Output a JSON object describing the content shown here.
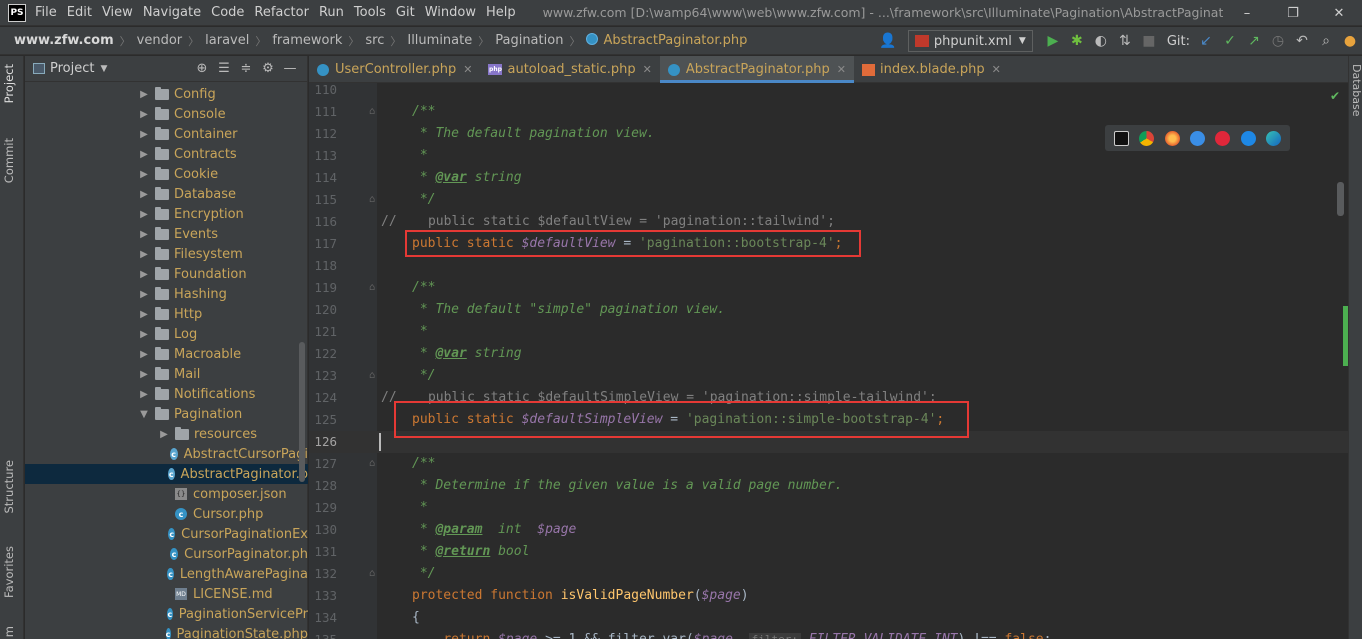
{
  "app": {
    "logo": "PS",
    "menu": [
      "File",
      "Edit",
      "View",
      "Navigate",
      "Code",
      "Refactor",
      "Run",
      "Tools",
      "Git",
      "Window",
      "Help"
    ],
    "window_title": "www.zfw.com [D:\\wamp64\\www\\web\\www.zfw.com] - ...\\framework\\src\\Illuminate\\Pagination\\AbstractPaginator.php",
    "controls": {
      "minimize": "–",
      "restore": "❐",
      "close": "✕"
    }
  },
  "breadcrumb": [
    "www.zfw.com",
    "vendor",
    "laravel",
    "framework",
    "src",
    "Illuminate",
    "Pagination",
    "AbstractPaginator.php"
  ],
  "toolbar": {
    "run_config": "phpunit.xml",
    "git_label": "Git:"
  },
  "left_strip": {
    "project": "Project",
    "commit": "Commit",
    "structure": "Structure",
    "favorites": "Favorites",
    "bottom": "m"
  },
  "right_strip": {
    "database": "Database"
  },
  "project_panel": {
    "title": "Project",
    "tree": [
      {
        "label": "Config",
        "type": "folder",
        "depth": 1
      },
      {
        "label": "Console",
        "type": "folder",
        "depth": 1
      },
      {
        "label": "Container",
        "type": "folder",
        "depth": 1
      },
      {
        "label": "Contracts",
        "type": "folder",
        "depth": 1
      },
      {
        "label": "Cookie",
        "type": "folder",
        "depth": 1
      },
      {
        "label": "Database",
        "type": "folder",
        "depth": 1
      },
      {
        "label": "Encryption",
        "type": "folder",
        "depth": 1
      },
      {
        "label": "Events",
        "type": "folder",
        "depth": 1
      },
      {
        "label": "Filesystem",
        "type": "folder",
        "depth": 1
      },
      {
        "label": "Foundation",
        "type": "folder",
        "depth": 1
      },
      {
        "label": "Hashing",
        "type": "folder",
        "depth": 1
      },
      {
        "label": "Http",
        "type": "folder",
        "depth": 1
      },
      {
        "label": "Log",
        "type": "folder",
        "depth": 1
      },
      {
        "label": "Macroable",
        "type": "folder",
        "depth": 1
      },
      {
        "label": "Mail",
        "type": "folder",
        "depth": 1
      },
      {
        "label": "Notifications",
        "type": "folder",
        "depth": 1
      },
      {
        "label": "Pagination",
        "type": "folder-open",
        "depth": 1
      },
      {
        "label": "resources",
        "type": "folder",
        "depth": 2
      },
      {
        "label": "AbstractCursorPagi",
        "type": "class-abstract",
        "depth": 2
      },
      {
        "label": "AbstractPaginator.p",
        "type": "class-abstract",
        "depth": 2,
        "selected": true
      },
      {
        "label": "composer.json",
        "type": "json",
        "depth": 2
      },
      {
        "label": "Cursor.php",
        "type": "class",
        "depth": 2
      },
      {
        "label": "CursorPaginationEx",
        "type": "class",
        "depth": 2
      },
      {
        "label": "CursorPaginator.ph",
        "type": "class",
        "depth": 2
      },
      {
        "label": "LengthAwarePagina",
        "type": "class",
        "depth": 2
      },
      {
        "label": "LICENSE.md",
        "type": "md",
        "depth": 2
      },
      {
        "label": "PaginationServicePr",
        "type": "class",
        "depth": 2
      },
      {
        "label": "PaginationState.php",
        "type": "class",
        "depth": 2
      }
    ]
  },
  "tabs": [
    {
      "label": "UserController.php",
      "icon": "class",
      "active": false
    },
    {
      "label": "autoload_static.php",
      "icon": "php",
      "active": false
    },
    {
      "label": "AbstractPaginator.php",
      "icon": "class",
      "active": true
    },
    {
      "label": "index.blade.php",
      "icon": "blade",
      "active": false
    }
  ],
  "editor": {
    "current_line": 126,
    "lines": [
      {
        "n": "110",
        "segs": []
      },
      {
        "n": "111",
        "segs": [
          [
            "c-doc",
            "/**"
          ]
        ]
      },
      {
        "n": "112",
        "segs": [
          [
            "c-doc",
            " * The default pagination view."
          ]
        ]
      },
      {
        "n": "113",
        "segs": [
          [
            "c-doc",
            " *"
          ]
        ]
      },
      {
        "n": "114",
        "segs": [
          [
            "c-doc",
            " * "
          ],
          [
            "c-tag",
            "@var"
          ],
          [
            "c-doc",
            " string"
          ]
        ]
      },
      {
        "n": "115",
        "segs": [
          [
            "c-doc",
            " */"
          ]
        ]
      },
      {
        "n": "116",
        "segs": [
          [
            "c-line",
            "//    public static $defaultView = 'pagination::tailwind';"
          ]
        ],
        "comment_out": true
      },
      {
        "n": "117",
        "segs": [
          [
            "kw",
            "public static "
          ],
          [
            "var",
            "$defaultView"
          ],
          [
            "pl",
            " = "
          ],
          [
            "str",
            "'pagination::bootstrap-4'"
          ],
          [
            "kw",
            ";"
          ]
        ]
      },
      {
        "n": "118",
        "segs": []
      },
      {
        "n": "119",
        "segs": [
          [
            "c-doc",
            "/**"
          ]
        ]
      },
      {
        "n": "120",
        "segs": [
          [
            "c-doc",
            " * The default \"simple\" pagination view."
          ]
        ]
      },
      {
        "n": "121",
        "segs": [
          [
            "c-doc",
            " *"
          ]
        ]
      },
      {
        "n": "122",
        "segs": [
          [
            "c-doc",
            " * "
          ],
          [
            "c-tag",
            "@var"
          ],
          [
            "c-doc",
            " string"
          ]
        ]
      },
      {
        "n": "123",
        "segs": [
          [
            "c-doc",
            " */"
          ]
        ]
      },
      {
        "n": "124",
        "segs": [
          [
            "c-line",
            "//    public static $defaultSimpleView = 'pagination::simple-tailwind';"
          ]
        ],
        "comment_out": true
      },
      {
        "n": "125",
        "segs": [
          [
            "kw",
            "public static "
          ],
          [
            "var",
            "$defaultSimpleView"
          ],
          [
            "pl",
            " = "
          ],
          [
            "str",
            "'pagination::simple-bootstrap-4'"
          ],
          [
            "kw",
            ";"
          ]
        ]
      },
      {
        "n": "126",
        "segs": []
      },
      {
        "n": "127",
        "segs": [
          [
            "c-doc",
            "/**"
          ]
        ]
      },
      {
        "n": "128",
        "segs": [
          [
            "c-doc",
            " * Determine if the given value is a valid page number."
          ]
        ]
      },
      {
        "n": "129",
        "segs": [
          [
            "c-doc",
            " *"
          ]
        ]
      },
      {
        "n": "130",
        "segs": [
          [
            "c-doc",
            " * "
          ],
          [
            "c-tag",
            "@param"
          ],
          [
            "c-doc",
            "  int  "
          ],
          [
            "var",
            "$page"
          ]
        ]
      },
      {
        "n": "131",
        "segs": [
          [
            "c-doc",
            " * "
          ],
          [
            "c-tag",
            "@return"
          ],
          [
            "c-doc",
            " bool"
          ]
        ]
      },
      {
        "n": "132",
        "segs": [
          [
            "c-doc",
            " */"
          ]
        ]
      },
      {
        "n": "133",
        "segs": [
          [
            "kw",
            "protected function "
          ],
          [
            "fn",
            "isValidPageNumber"
          ],
          [
            "pl",
            "("
          ],
          [
            "var",
            "$page"
          ],
          [
            "pl",
            ")"
          ]
        ]
      },
      {
        "n": "134",
        "segs": [
          [
            "pl",
            "{"
          ]
        ]
      },
      {
        "n": "135",
        "segs": [
          [
            "pl",
            "    "
          ],
          [
            "kw",
            "return "
          ],
          [
            "var",
            "$page"
          ],
          [
            "pl",
            " >= 1 && filter_var("
          ],
          [
            "var",
            "$page"
          ],
          [
            "pl",
            ", "
          ],
          [
            "hint",
            "filter:"
          ],
          [
            "var",
            " FILTER_VALIDATE_INT"
          ],
          [
            "pl",
            ") !== "
          ],
          [
            "kw",
            "false"
          ],
          [
            "pl",
            ";"
          ]
        ]
      }
    ]
  },
  "colors": {
    "highlight_box": "#e53935",
    "accent": "#4a88c7"
  }
}
